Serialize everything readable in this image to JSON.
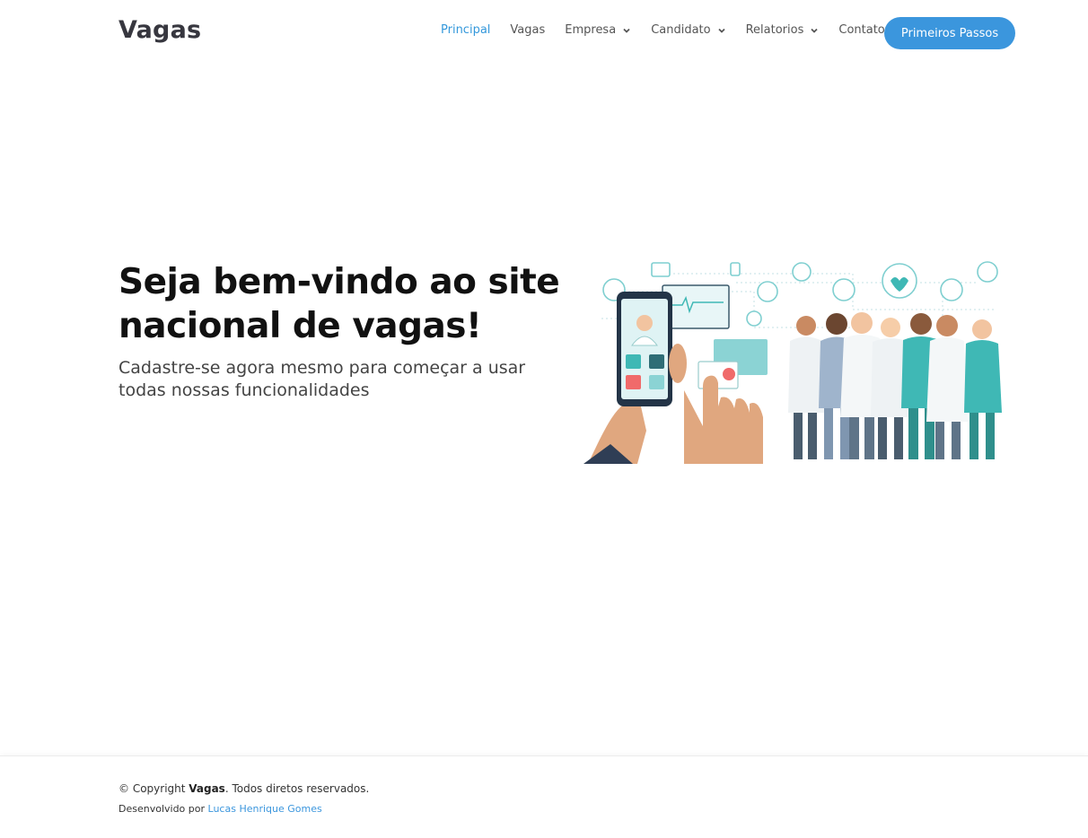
{
  "header": {
    "logo": "Vagas",
    "nav": [
      {
        "label": "Principal",
        "active": true,
        "dropdown": false
      },
      {
        "label": "Vagas",
        "active": false,
        "dropdown": false
      },
      {
        "label": "Empresa",
        "active": false,
        "dropdown": true
      },
      {
        "label": "Candidato",
        "active": false,
        "dropdown": true
      },
      {
        "label": "Relatorios",
        "active": false,
        "dropdown": true
      },
      {
        "label": "Contato",
        "active": false,
        "dropdown": false
      }
    ],
    "cta_label": "Primeiros Passos"
  },
  "hero": {
    "title_line1": "Seja bem-vindo ao site",
    "title_line2": "nacional de vagas!",
    "subtitle_line1": "Cadastre-se agora mesmo para começar a usar",
    "subtitle_line2": "todas nossas funcionalidades",
    "illustration": "medical-team-telemedicine-illustration"
  },
  "footer": {
    "copyright_prefix": "© Copyright ",
    "copyright_brand": "Vagas",
    "copyright_suffix": ". Todos diretos reservados.",
    "dev_prefix": "Desenvolvido por ",
    "dev_author": "Lucas Henrique Gomes"
  },
  "colors": {
    "accent": "#3b96dd",
    "teal": "#3fb8b5",
    "text_dark": "#111111"
  }
}
